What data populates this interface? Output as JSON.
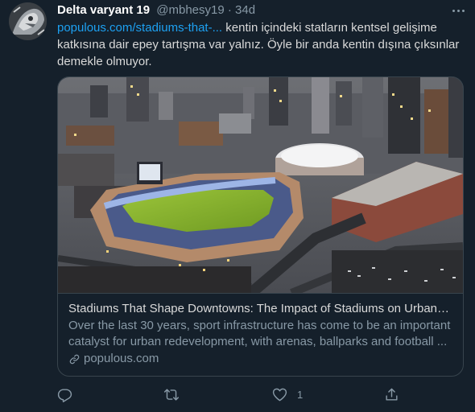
{
  "tweet": {
    "display_name": "Delta varyant 19",
    "handle": "@mbhesy19",
    "separator": "·",
    "time": "34d",
    "text_link": "populous.com/stadiums-that-...",
    "text_body": " kentin içindeki statların kentsel gelişime katkısına dair epey tartışma var yalnız. Öyle bir anda kentin dışına çıksınlar demekle olmuyor."
  },
  "card": {
    "title": "Stadiums That Shape Downtowns: The Impact of Stadiums on Urban R...",
    "description": "Over the last 30 years, sport infrastructure has come to be an important catalyst for urban redevelopment, with arenas, ballparks and football ...",
    "domain": "populous.com",
    "domain_icon": "link-icon",
    "image_subject": "aerial-city-stadium-dusk"
  },
  "actions": {
    "reply_icon": "reply-icon",
    "retweet_icon": "retweet-icon",
    "like_icon": "heart-icon",
    "like_count": "1",
    "share_icon": "share-icon"
  },
  "colors": {
    "background": "#15202b",
    "link": "#1da1f2",
    "secondary_text": "#8899a6",
    "border": "#38444d"
  }
}
